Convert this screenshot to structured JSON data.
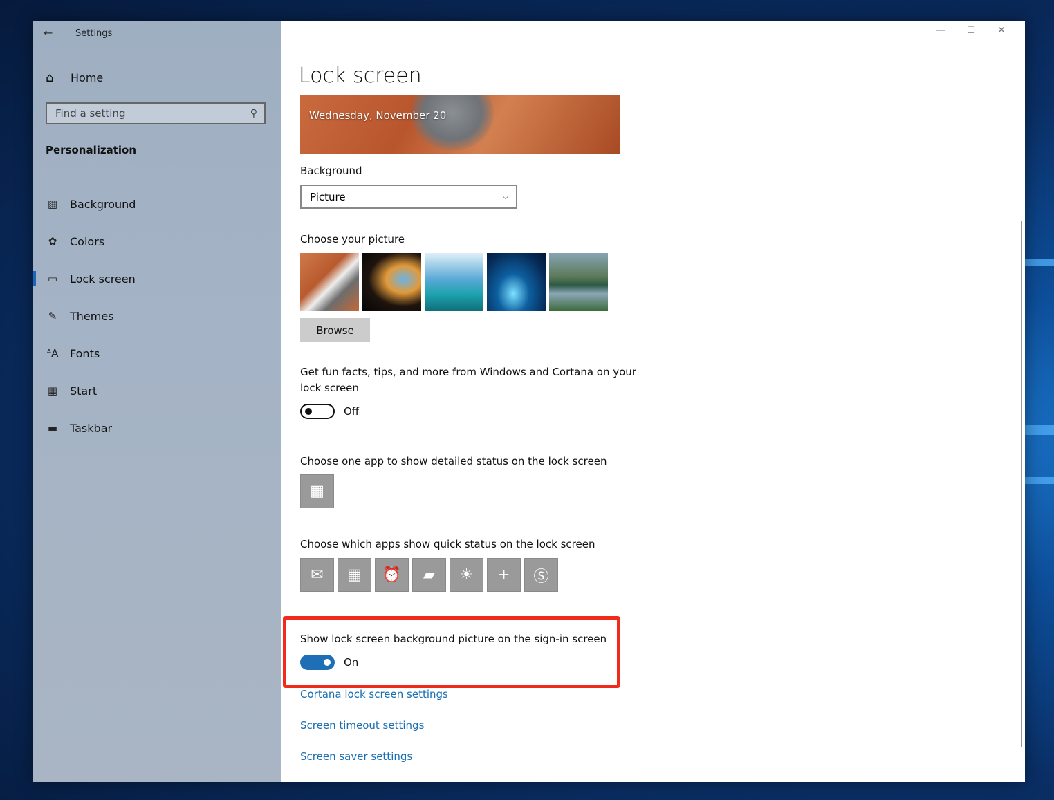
{
  "app": {
    "title": "Settings"
  },
  "window_controls": {
    "minimize": "—",
    "maximize": "☐",
    "close": "✕"
  },
  "sidebar": {
    "home_label": "Home",
    "search_placeholder": "Find a setting",
    "section_title": "Personalization",
    "items": [
      {
        "label": "Background",
        "icon": "image-icon"
      },
      {
        "label": "Colors",
        "icon": "palette-icon"
      },
      {
        "label": "Lock screen",
        "icon": "lock-screen-icon",
        "active": true
      },
      {
        "label": "Themes",
        "icon": "themes-icon"
      },
      {
        "label": "Fonts",
        "icon": "fonts-icon"
      },
      {
        "label": "Start",
        "icon": "start-icon"
      },
      {
        "label": "Taskbar",
        "icon": "taskbar-icon"
      }
    ]
  },
  "main": {
    "page_title": "Lock screen",
    "preview_date": "Wednesday, November 20",
    "background_label": "Background",
    "background_value": "Picture",
    "choose_picture_label": "Choose your picture",
    "browse_label": "Browse",
    "fun_facts_label": "Get fun facts, tips, and more from Windows and Cortana on your lock screen",
    "fun_facts_state": "Off",
    "detailed_status_label": "Choose one app to show detailed status on the lock screen",
    "quick_status_label": "Choose which apps show quick status on the lock screen",
    "quick_status_apps": [
      "mail-icon",
      "calendar-icon",
      "alarm-icon",
      "messaging-icon",
      "weather-icon",
      "add-icon",
      "skype-icon"
    ],
    "signin_label": "Show lock screen background picture on the sign-in screen",
    "signin_state": "On",
    "links": [
      "Cortana lock screen settings",
      "Screen timeout settings",
      "Screen saver settings"
    ]
  },
  "colors": {
    "accent": "#1f6fb6",
    "link": "#1a6fb3",
    "highlight": "#f02b1b"
  }
}
